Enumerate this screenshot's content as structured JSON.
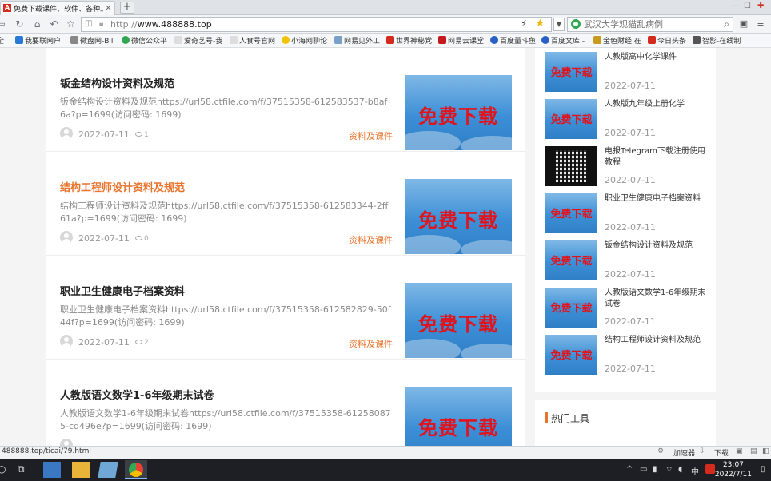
{
  "browser": {
    "tab_title": "免费下载课件、软件、各种工具",
    "new_tab": "+",
    "address": {
      "protocol": "http://",
      "host": "www.488888.top"
    },
    "search_placeholder": "武汉大学观猫乱病例"
  },
  "bookmarks": [
    {
      "label": "我要联网户",
      "color": "#2a7ad5"
    },
    {
      "label": "微盘网-Bil",
      "color": "#888888"
    },
    {
      "label": "微信公众平",
      "color": "#2fa84f"
    },
    {
      "label": "爱奇艺号-我",
      "color": "#aaaaaa"
    },
    {
      "label": "人食号官网",
      "color": "#aaaaaa"
    },
    {
      "label": "小海网聊论",
      "color": "#f2c200"
    },
    {
      "label": "网易见外工",
      "color": "#7aa0c8"
    },
    {
      "label": "世界神秘党",
      "color": "#d52b1e"
    },
    {
      "label": "网易云课堂",
      "color": "#c5181f"
    },
    {
      "label": "百度量斗鱼",
      "color": "#2a5fc8"
    },
    {
      "label": "百度文库 -",
      "color": "#2a5fc8"
    },
    {
      "label": "金色财经 在",
      "color": "#c89a20"
    },
    {
      "label": "今日头条",
      "color": "#d52b1e"
    },
    {
      "label": "智影-在线制",
      "color": "#555555"
    }
  ],
  "posts": [
    {
      "title": "钣金结构设计资料及规范",
      "excerpt": "钣金结构设计资料及规范https://url58.ctfile.com/f/37515358-612583537-b8af6a?p=1699(访问密码: 1699)",
      "date": "2022-07-11",
      "views": "1",
      "category": "资料及课件",
      "thumb_text": "免费下载"
    },
    {
      "title": "结构工程师设计资料及规范",
      "excerpt": "结构工程师设计资料及规范https://url58.ctfile.com/f/37515358-612583344-2ff61a?p=1699(访问密码: 1699)",
      "date": "2022-07-11",
      "views": "0",
      "category": "资料及课件",
      "thumb_text": "免费下载"
    },
    {
      "title": "职业卫生健康电子档案资料",
      "excerpt": "职业卫生健康电子档案资料https://url58.ctfile.com/f/37515358-612582829-50f44f?p=1699(访问密码: 1699)",
      "date": "2022-07-11",
      "views": "2",
      "category": "资料及课件",
      "thumb_text": "免费下载"
    },
    {
      "title": "人教版语文数学1-6年级期末试卷",
      "excerpt": "人教版语文数学1-6年级期末试卷https://url58.ctfile.com/f/37515358-612580875-cd496e?p=1699(访问密码: 1699)",
      "date": "",
      "views": "",
      "category": "",
      "thumb_text": "免费下载"
    }
  ],
  "sidebar": {
    "items": [
      {
        "title": "人教版高中化学课件",
        "date": "2022-07-11",
        "thumb": "免费下载"
      },
      {
        "title": "人教版九年级上册化学",
        "date": "2022-07-11",
        "thumb": "免费下载"
      },
      {
        "title": "电报Telegram下载注册使用教程",
        "date": "2022-07-11",
        "thumb": "qr"
      },
      {
        "title": "职业卫生健康电子档案资料",
        "date": "2022-07-11",
        "thumb": "免费下载"
      },
      {
        "title": "钣金结构设计资料及规范",
        "date": "2022-07-11",
        "thumb": "免费下载"
      },
      {
        "title": "人教版语文数学1-6年级期末试卷",
        "date": "2022-07-11",
        "thumb": "免费下载"
      },
      {
        "title": "结构工程师设计资料及规范",
        "date": "2022-07-11",
        "thumb": "免费下载"
      }
    ],
    "hot_title": "热门工具"
  },
  "statusbar": {
    "link_url": "488888.top/ticai/79.html",
    "accelerator": "加速器",
    "download": "下载"
  },
  "taskbar": {
    "time": "23:07",
    "date": "2022/7/11",
    "ime": "中"
  },
  "colors": {
    "accent": "#e8732c",
    "thumb_text": "#e0141e"
  }
}
